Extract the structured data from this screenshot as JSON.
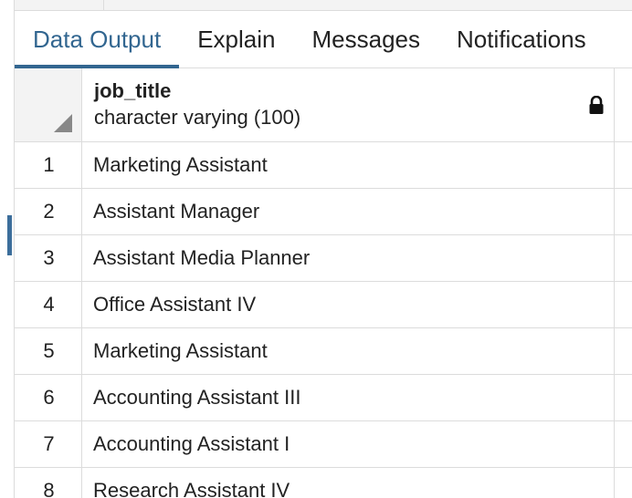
{
  "tabs": [
    {
      "label": "Data Output",
      "active": true
    },
    {
      "label": "Explain",
      "active": false
    },
    {
      "label": "Messages",
      "active": false
    },
    {
      "label": "Notifications",
      "active": false
    }
  ],
  "grid": {
    "column": {
      "name": "job_title",
      "type": "character varying (100)",
      "icon": "lock-icon"
    },
    "rows": [
      {
        "num": "1",
        "value": "Marketing Assistant"
      },
      {
        "num": "2",
        "value": "Assistant Manager"
      },
      {
        "num": "3",
        "value": "Assistant Media Planner"
      },
      {
        "num": "4",
        "value": "Office Assistant IV"
      },
      {
        "num": "5",
        "value": "Marketing Assistant"
      },
      {
        "num": "6",
        "value": "Accounting Assistant III"
      },
      {
        "num": "7",
        "value": "Accounting Assistant I"
      },
      {
        "num": "8",
        "value": "Research Assistant IV"
      }
    ]
  },
  "colors": {
    "accent": "#326690",
    "gridline": "#dcdcdc",
    "header_bg": "#f3f3f3"
  }
}
